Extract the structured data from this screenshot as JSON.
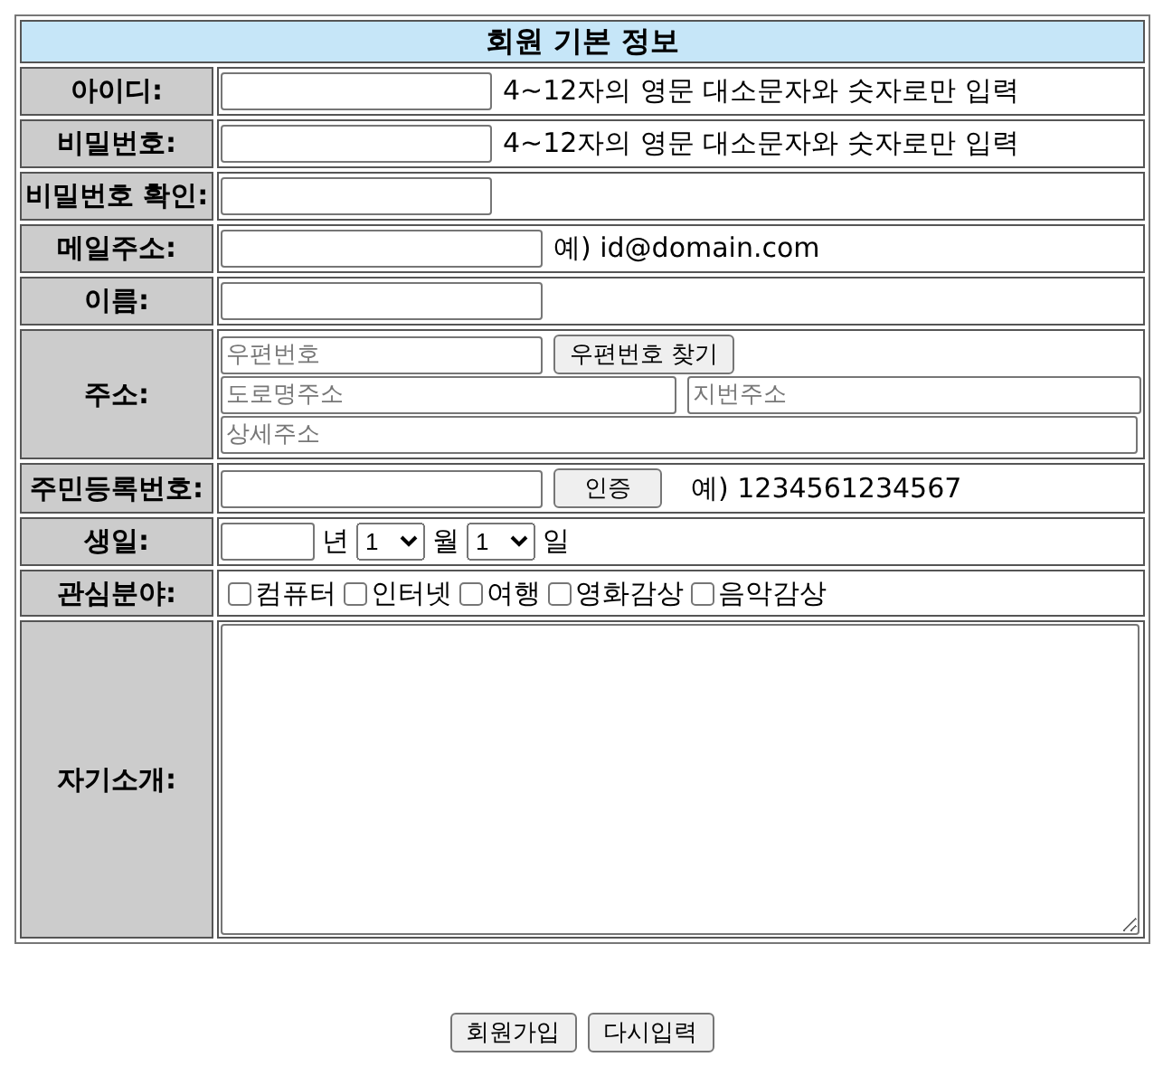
{
  "title": "회원 기본 정보",
  "rows": [
    {
      "kind": "short-field",
      "label": "아이디:",
      "hint": "4~12자의 영문 대소문자와 숫자로만 입력"
    },
    {
      "kind": "short-field",
      "label": "비밀번호:",
      "hint": "4~12자의 영문 대소문자와 숫자로만 입력"
    },
    {
      "kind": "short-field",
      "label": "비밀번호 확인:"
    },
    {
      "kind": "long-field",
      "label": "메일주소:",
      "hint": "예) id@domain.com"
    },
    {
      "kind": "long-field",
      "label": "이름:"
    },
    {
      "kind": "address",
      "label": "주소:",
      "zip": {
        "placeholder": "우편번호"
      },
      "zip_button": "우편번호 찾기",
      "road": {
        "placeholder": "도로명주소"
      },
      "lot": {
        "placeholder": "지번주소"
      },
      "detail": {
        "placeholder": "상세주소"
      }
    },
    {
      "kind": "ssn",
      "label": "주민등록번호:",
      "button": "인증",
      "hint": "예) 1234561234567"
    },
    {
      "kind": "birthday",
      "label": "생일:",
      "year_unit": "년",
      "month": "1",
      "month_unit": "월",
      "day": "1",
      "day_unit": "일"
    },
    {
      "kind": "interests",
      "label": "관심분야:",
      "options": [
        {
          "label": "컴퓨터",
          "checked": false
        },
        {
          "label": "인터넷",
          "checked": false
        },
        {
          "label": "여행",
          "checked": false
        },
        {
          "label": "영화감상",
          "checked": false
        },
        {
          "label": "음악감상",
          "checked": false
        }
      ]
    },
    {
      "kind": "textarea",
      "label": "자기소개:"
    }
  ],
  "buttons": [
    "회원가입",
    "다시입력"
  ]
}
